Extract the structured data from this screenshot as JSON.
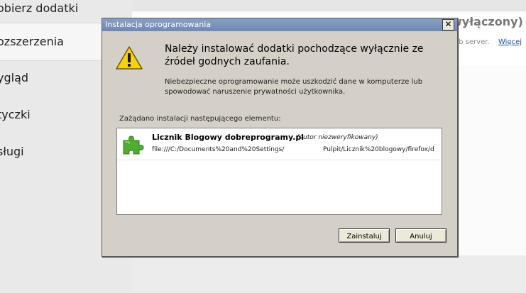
{
  "background": {
    "sidebar": {
      "items": [
        {
          "label": "obierz dodatki"
        },
        {
          "label": "ozszerzenia"
        },
        {
          "label": "ygląd"
        },
        {
          "label": "tyczki"
        },
        {
          "label": "sługi"
        }
      ]
    },
    "addon_status": "wyłączony)",
    "addon_desc": "eb server.",
    "more_link": "Więcej"
  },
  "dialog": {
    "title": "Instalacja oprogramowania",
    "close_glyph": "✕",
    "heading": "Należy instalować dodatki pochodzące wyłącznie ze źródeł godnych zaufania.",
    "warning": "Niebezpieczne oprogramowanie może uszkodzić dane w komputerze lub spowodować naruszenie prywatności użytkownika.",
    "list_caption": "Zażądano instalacji następującego elementu:",
    "item": {
      "name": "Licznik Blogowy dobreprogramy.pl",
      "author": "(autor niezweryfikowany)",
      "url_part1": "file:///C:/Documents%20and%20Settings/",
      "url_part2": "Pulpit/Licznik%20blogowy/firefox/d"
    },
    "buttons": {
      "install": "Zainstaluj",
      "cancel": "Anuluj"
    },
    "icons": {
      "warning": "warning-icon",
      "addon": "puzzle-icon"
    }
  }
}
